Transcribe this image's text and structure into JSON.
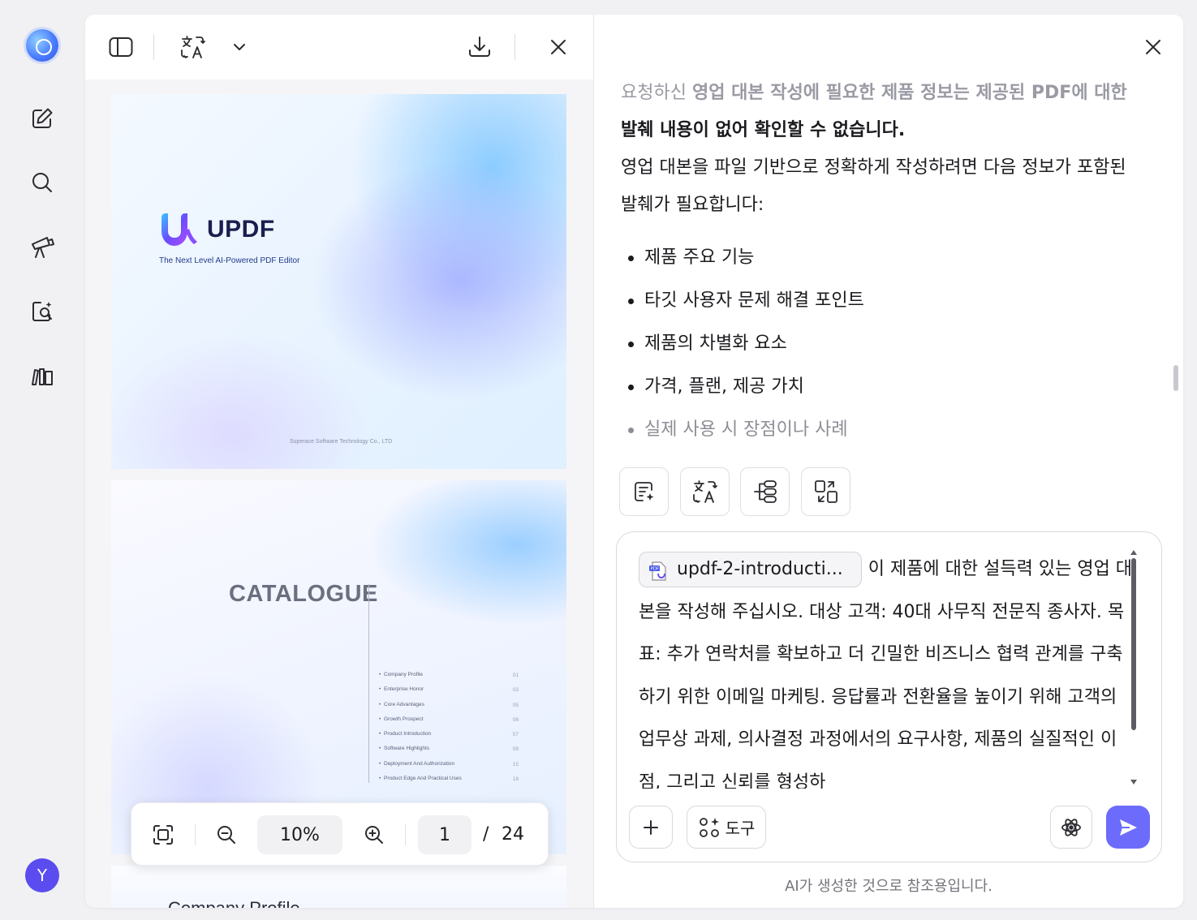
{
  "rail": {
    "icons": [
      "app-logo-icon",
      "edit-icon",
      "search-icon",
      "present-icon",
      "search-document-icon",
      "library-icon"
    ],
    "avatar_initial": "Y"
  },
  "viewer": {
    "toolbar": {
      "icons": [
        "sidebar-toggle-icon",
        "translate-icon",
        "chevron-down-icon",
        "download-icon",
        "close-icon"
      ]
    },
    "page1": {
      "brand": "UPDF",
      "tagline": "The Next Level AI-Powered PDF Editor",
      "company": "Superace Software Technology Co., LTD"
    },
    "page2": {
      "title": "CATALOGUE",
      "toc": [
        {
          "label": "Company Profile",
          "num": "01"
        },
        {
          "label": "Enterprise Honor",
          "num": "03"
        },
        {
          "label": "Core Advantages",
          "num": "05"
        },
        {
          "label": "Growth Prospect",
          "num": "06"
        },
        {
          "label": "Product Introduction",
          "num": "07"
        },
        {
          "label": "Software Highlights",
          "num": "09"
        },
        {
          "label": "Deployment And Authorization",
          "num": "15"
        },
        {
          "label": "Product Edge And Practical Uses",
          "num": "18"
        }
      ]
    },
    "page3": {
      "title": "Company Profile"
    },
    "zoom": {
      "level": "10%",
      "page_current": "1",
      "page_separator": "/",
      "page_total": "24"
    }
  },
  "ai": {
    "response": {
      "line1_fade": "요청하신 ",
      "line1_bold": "영업 대본 작성에 필요한 제품 정보는 제공된 PDF에 대한",
      "line2_bold": "발췌 내용이 없어 확인할 수 없습니다.",
      "line3": "영업 대본을 파일 기반으로 정확하게 작성하려면 다음 정보가 포함된",
      "line4": "발췌가 필요합니다:",
      "bullets": [
        "제품 주요 기능",
        "타깃 사용자 문제 해결 포인트",
        "제품의 차별화 요소",
        "가격, 플랜, 제공 가치",
        "실제 사용 시 장점이나 사례"
      ]
    },
    "quick_actions": [
      "summarize-icon",
      "translate-icon",
      "mindmap-icon",
      "convert-icon"
    ],
    "composer": {
      "file_chip": "updf-2-introducti...",
      "text": "이 제품에 대한 설득력 있는 영업 대본을 작성해 주십시오. 대상 고객: 40대 사무직 전문직 종사자. 목표: 추가 연락처를 확보하고 더 긴밀한 비즈니스 협력 관계를 구축하기 위한 이메일 마케팅. 응답률과 전환율을 높이기 위해 고객의 업무상 과제, 의사결정 과정에서의 요구사항, 제품의 실질적인 이점, 그리고 신뢰를 형성하",
      "tools_label": "도구"
    },
    "disclaimer": "AI가 생성한 것으로 참조용입니다.",
    "accent_color": "#6c6bfb"
  }
}
